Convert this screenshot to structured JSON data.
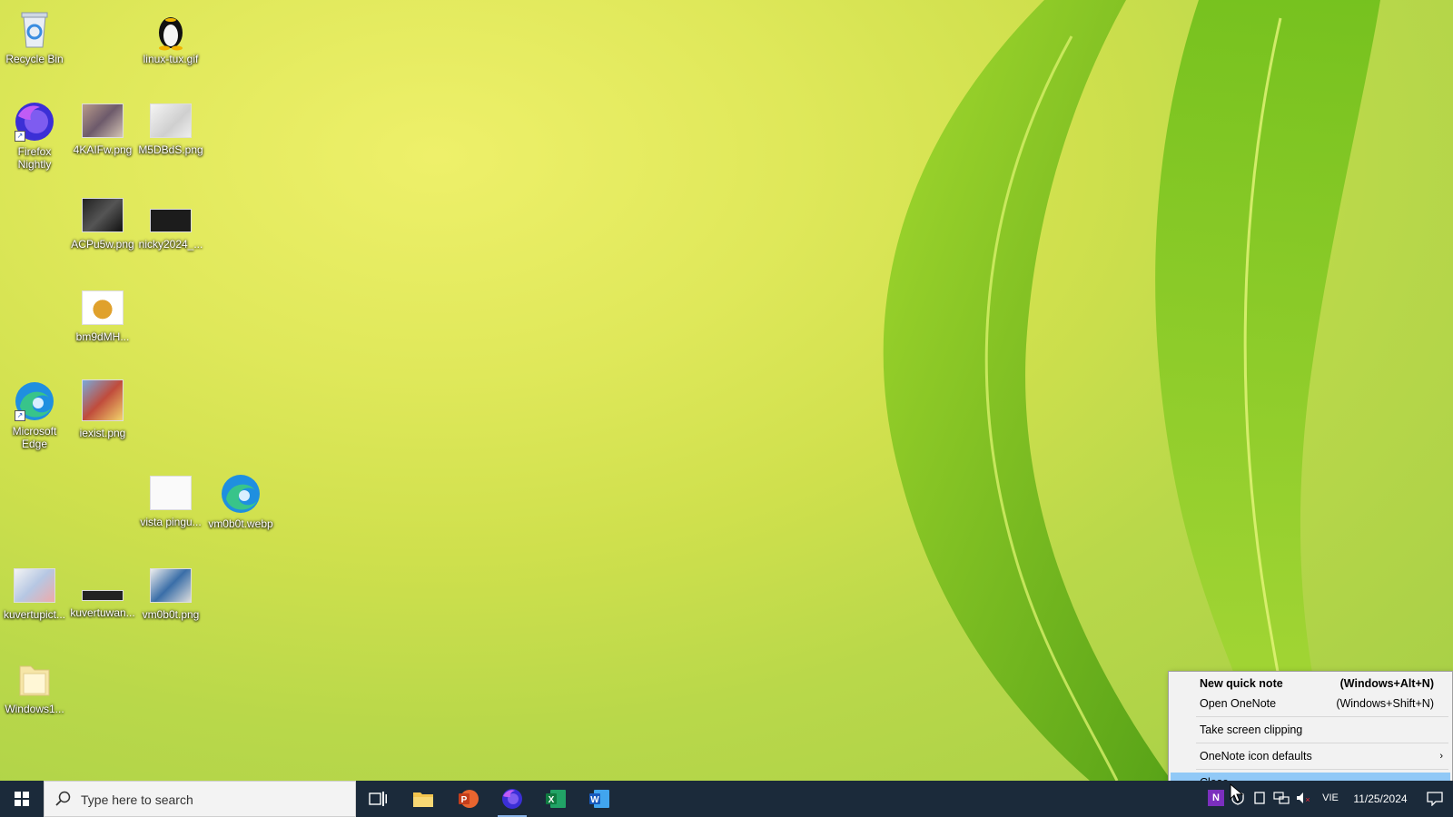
{
  "desktop_icons": [
    {
      "label": "Recycle Bin"
    },
    {
      "label": "linux-tux.gif"
    },
    {
      "label": "Firefox Nightly"
    },
    {
      "label": "4KAIFw.png"
    },
    {
      "label": "M5DBdS.png"
    },
    {
      "label": "ACPu5w.png"
    },
    {
      "label": "nicky2024_..."
    },
    {
      "label": "bm9dMH..."
    },
    {
      "label": "Microsoft Edge"
    },
    {
      "label": "iexist.png"
    },
    {
      "label": "vista pingu..."
    },
    {
      "label": "vm0b0t.webp"
    },
    {
      "label": "kuvertupict..."
    },
    {
      "label": "kuvertuwan..."
    },
    {
      "label": "vm0b0t.png"
    },
    {
      "label": "Windows1..."
    }
  ],
  "context_menu": {
    "items": [
      {
        "label": "New quick note",
        "shortcut": "(Windows+Alt+N)"
      },
      {
        "label": "Open OneNote",
        "shortcut": "(Windows+Shift+N)"
      },
      {
        "label": "Take screen clipping"
      },
      {
        "label": "OneNote icon defaults"
      },
      {
        "label": "Close"
      }
    ]
  },
  "taskbar": {
    "search_placeholder": "Type here to search",
    "language": "VIE",
    "date": "11/25/2024"
  },
  "colors": {
    "taskbar_bg": "#1b2a3a",
    "menu_highlight": "#91c9f7",
    "onenote_purple": "#7b2fbe"
  }
}
